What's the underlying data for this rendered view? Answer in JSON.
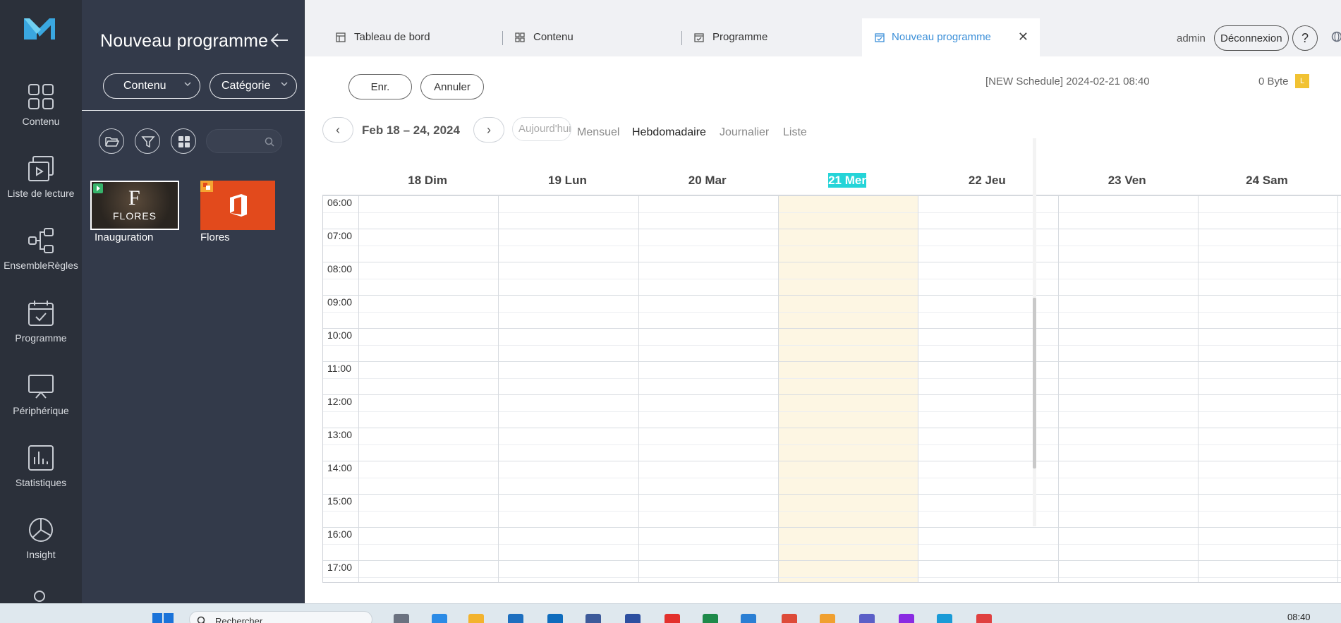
{
  "nav": {
    "items": [
      {
        "label": "Contenu",
        "icon": "grid-icon"
      },
      {
        "label": "Liste de lecture",
        "icon": "playlist-icon"
      },
      {
        "label": "EnsembleRègles",
        "icon": "rules-icon"
      },
      {
        "label": "Programme",
        "icon": "calendar-icon"
      },
      {
        "label": "Périphérique",
        "icon": "display-icon"
      },
      {
        "label": "Statistiques",
        "icon": "chart-icon"
      },
      {
        "label": "Insight",
        "icon": "pie-icon"
      }
    ]
  },
  "library": {
    "title": "Nouveau programme",
    "content_select": "Contenu",
    "category_select": "Catégorie",
    "search_placeholder": "",
    "items": [
      {
        "label": "Inauguration",
        "thumb_text": "FLORES",
        "type": "video"
      },
      {
        "label": "Flores",
        "thumb_text": "",
        "type": "office"
      }
    ]
  },
  "topbar": {
    "tabs": [
      {
        "label": "Tableau de bord"
      },
      {
        "label": "Contenu"
      },
      {
        "label": "Programme"
      }
    ],
    "active_tab": "Nouveau programme",
    "user": "admin",
    "logout": "Déconnexion",
    "help": "?"
  },
  "toolbar": {
    "save": "Enr.",
    "cancel": "Annuler",
    "schedule_info": "[NEW Schedule] 2024-02-21 08:40",
    "size": "0 Byte",
    "size_badge": "L"
  },
  "calendar": {
    "range": "Feb 18 – 24, 2024",
    "prev": "‹",
    "next": "›",
    "today": "Aujourd'hui",
    "views": [
      "Mensuel",
      "Hebdomadaire",
      "Journalier",
      "Liste"
    ],
    "active_view": "Hebdomadaire",
    "days": [
      "18 Dim",
      "19 Lun",
      "20 Mar",
      "21 Mer",
      "22 Jeu",
      "23 Ven",
      "24 Sam"
    ],
    "today_index": 3,
    "times": [
      "06:00",
      "07:00",
      "08:00",
      "09:00",
      "10:00",
      "11:00",
      "12:00",
      "13:00",
      "14:00",
      "15:00",
      "16:00",
      "17:00"
    ]
  },
  "taskbar": {
    "search_text": "Rechercher",
    "clock": "08:40"
  },
  "colors": {
    "nav_bg": "#2b303a",
    "panel_bg": "#333a4a",
    "accent": "#3b8fd8",
    "today_highlight": "#25d4d8",
    "today_column": "#fdf6e3"
  }
}
